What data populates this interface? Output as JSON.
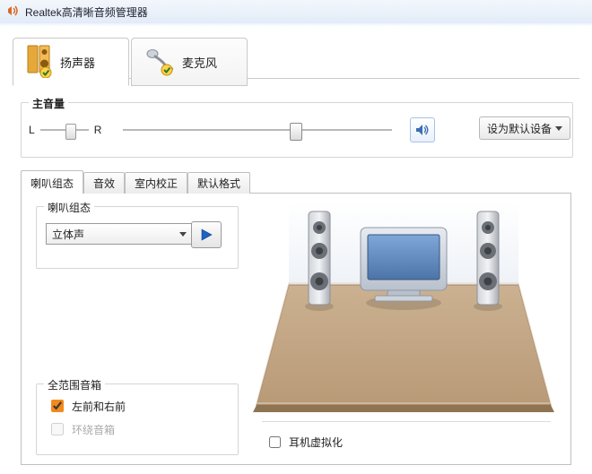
{
  "title": "Realtek高清晰音频管理器",
  "device_tabs": {
    "speaker": "扬声器",
    "mic": "麦克风"
  },
  "main_volume": {
    "legend": "主音量",
    "L": "L",
    "R": "R",
    "balance_pos_pct": 55,
    "level_pos_pct": 63
  },
  "set_default_label": "设为默认设备",
  "sub_tabs": {
    "config": "喇叭组态",
    "effects": "音效",
    "room": "室内校正",
    "default_fmt": "默认格式"
  },
  "speaker_config": {
    "legend": "喇叭组态",
    "selected": "立体声"
  },
  "full_range": {
    "legend": "全范围音箱",
    "front_label": "左前和右前",
    "front_checked": true,
    "surround_label": "环绕音箱",
    "surround_checked": false
  },
  "headphone_virt": {
    "label": "耳机虚拟化",
    "checked": false
  }
}
